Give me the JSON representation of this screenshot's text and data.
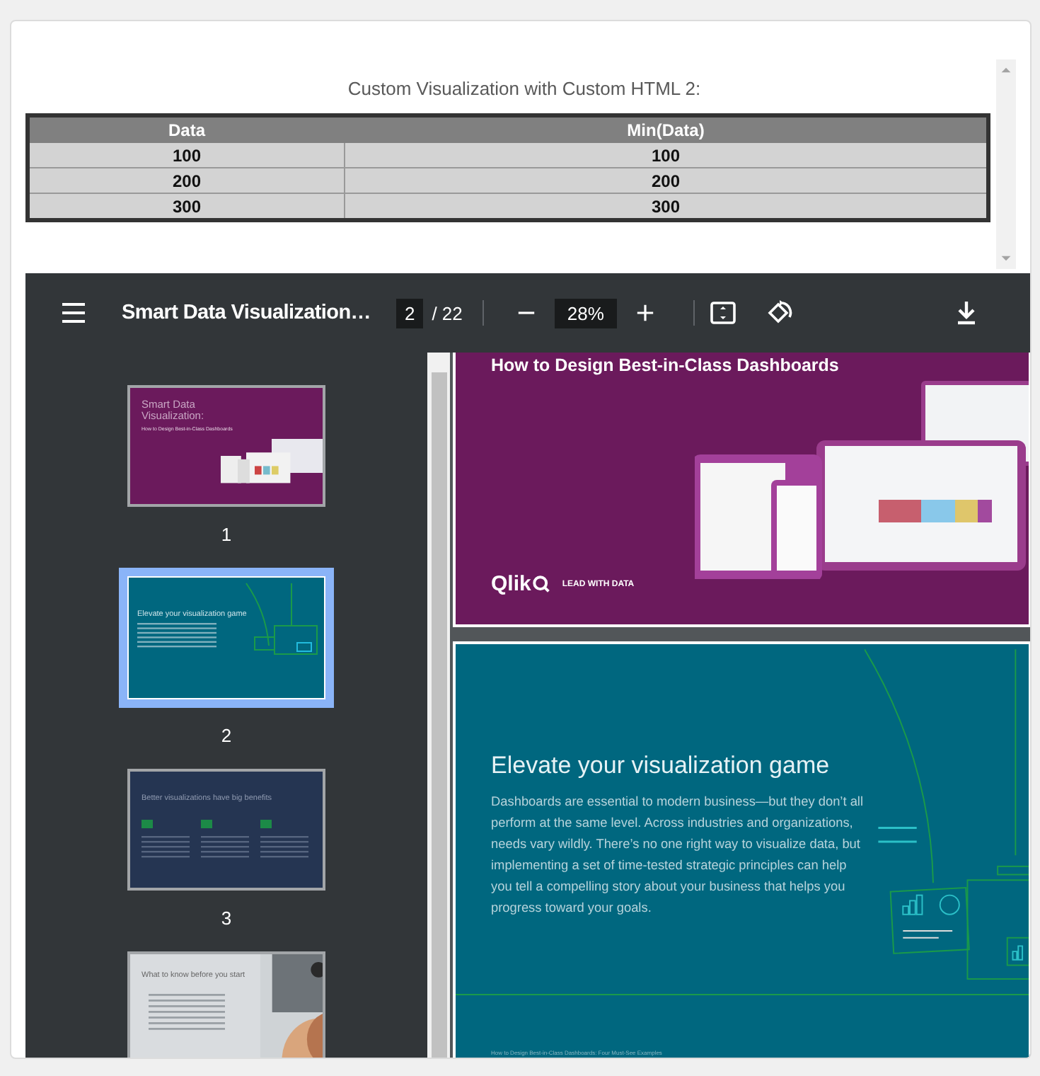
{
  "panel": {
    "title": "Custom Visualization with Custom HTML 2:"
  },
  "table": {
    "columns": [
      "Data",
      "Min(Data)"
    ],
    "rows": [
      [
        "100",
        "100"
      ],
      [
        "200",
        "200"
      ],
      [
        "300",
        "300"
      ]
    ]
  },
  "pdf_viewer": {
    "toolbar": {
      "title": "Smart Data Visualization…",
      "page_input": "2",
      "page_total": "/ 22",
      "zoom": "28%"
    },
    "thumbnails": [
      {
        "label": "1",
        "selected": false,
        "kind": "cover",
        "title": "Smart Data Visualization:",
        "subtitle": "How to Design Best-in-Class Dashboards"
      },
      {
        "label": "2",
        "selected": true,
        "kind": "teal",
        "title": "Elevate your visualization game"
      },
      {
        "label": "3",
        "selected": false,
        "kind": "navy",
        "title": "Better visualizations have big benefits"
      },
      {
        "title": "What to know before you start"
      }
    ],
    "pages": [
      {
        "kind": "cover",
        "subtitle": "How to Design Best-in-Class Dashboards",
        "logo": "Qlik",
        "tagline": "LEAD WITH DATA"
      },
      {
        "kind": "teal",
        "title": "Elevate your visualization game",
        "body": "Dashboards are essential to modern business—but they don’t all perform at the same level. Across industries and organizations, needs vary wildly. There’s no one right way to visualize data, but implementing a set of time-tested strategic principles can help you tell a compelling story about your business that helps you progress toward your goals.",
        "footer": "How to Design Best-in-Class Dashboards: Four Must-See Examples"
      }
    ]
  }
}
